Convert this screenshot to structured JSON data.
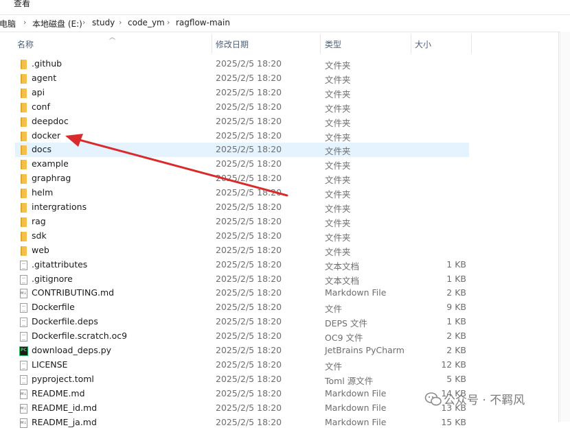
{
  "menu": {
    "view": "查看"
  },
  "breadcrumb": [
    "此电脑",
    "本地磁盘 (E:)",
    "study",
    "code_ym",
    "ragflow-main"
  ],
  "columns": {
    "name": "名称",
    "date": "修改日期",
    "type": "类型",
    "size": "大小"
  },
  "files": [
    {
      "name": ".github",
      "date": "2025/2/5 18:20",
      "type": "文件夹",
      "size": "",
      "icon": "folder-icon"
    },
    {
      "name": "agent",
      "date": "2025/2/5 18:20",
      "type": "文件夹",
      "size": "",
      "icon": "folder-icon"
    },
    {
      "name": "api",
      "date": "2025/2/5 18:20",
      "type": "文件夹",
      "size": "",
      "icon": "folder-icon"
    },
    {
      "name": "conf",
      "date": "2025/2/5 18:20",
      "type": "文件夹",
      "size": "",
      "icon": "folder-icon"
    },
    {
      "name": "deepdoc",
      "date": "2025/2/5 18:20",
      "type": "文件夹",
      "size": "",
      "icon": "folder-icon"
    },
    {
      "name": "docker",
      "date": "2025/2/5 18:20",
      "type": "文件夹",
      "size": "",
      "icon": "folder-icon"
    },
    {
      "name": "docs",
      "date": "2025/2/5 18:20",
      "type": "文件夹",
      "size": "",
      "icon": "folder-icon",
      "selected": true
    },
    {
      "name": "example",
      "date": "2025/2/5 18:20",
      "type": "文件夹",
      "size": "",
      "icon": "folder-icon"
    },
    {
      "name": "graphrag",
      "date": "2025/2/5 18:20",
      "type": "文件夹",
      "size": "",
      "icon": "folder-icon"
    },
    {
      "name": "helm",
      "date": "2025/2/5 18:20",
      "type": "文件夹",
      "size": "",
      "icon": "folder-icon"
    },
    {
      "name": "intergrations",
      "date": "2025/2/5 18:20",
      "type": "文件夹",
      "size": "",
      "icon": "folder-icon"
    },
    {
      "name": "rag",
      "date": "2025/2/5 18:20",
      "type": "文件夹",
      "size": "",
      "icon": "folder-icon"
    },
    {
      "name": "sdk",
      "date": "2025/2/5 18:20",
      "type": "文件夹",
      "size": "",
      "icon": "folder-icon"
    },
    {
      "name": "web",
      "date": "2025/2/5 18:20",
      "type": "文件夹",
      "size": "",
      "icon": "folder-icon"
    },
    {
      "name": ".gitattributes",
      "date": "2025/2/5 18:20",
      "type": "文本文档",
      "size": "1 KB",
      "icon": "text-file-icon"
    },
    {
      "name": ".gitignore",
      "date": "2025/2/5 18:20",
      "type": "文本文档",
      "size": "1 KB",
      "icon": "text-file-icon"
    },
    {
      "name": "CONTRIBUTING.md",
      "date": "2025/2/5 18:20",
      "type": "Markdown File",
      "size": "2 KB",
      "icon": "markdown-file-icon"
    },
    {
      "name": "Dockerfile",
      "date": "2025/2/5 18:20",
      "type": "文件",
      "size": "9 KB",
      "icon": "file-icon"
    },
    {
      "name": "Dockerfile.deps",
      "date": "2025/2/5 18:20",
      "type": "DEPS 文件",
      "size": "1 KB",
      "icon": "file-icon"
    },
    {
      "name": "Dockerfile.scratch.oc9",
      "date": "2025/2/5 18:20",
      "type": "OC9 文件",
      "size": "2 KB",
      "icon": "file-icon"
    },
    {
      "name": "download_deps.py",
      "date": "2025/2/5 18:20",
      "type": "JetBrains PyCharm",
      "size": "2 KB",
      "icon": "pycharm-file-icon"
    },
    {
      "name": "LICENSE",
      "date": "2025/2/5 18:20",
      "type": "文件",
      "size": "12 KB",
      "icon": "file-icon"
    },
    {
      "name": "pyproject.toml",
      "date": "2025/2/5 18:20",
      "type": "Toml 源文件",
      "size": "5 KB",
      "icon": "file-icon"
    },
    {
      "name": "README.md",
      "date": "2025/2/5 18:20",
      "type": "Markdown File",
      "size": "14 KB",
      "icon": "markdown-file-icon"
    },
    {
      "name": "README_id.md",
      "date": "2025/2/5 18:20",
      "type": "Markdown File",
      "size": "13 KB",
      "icon": "markdown-file-icon"
    },
    {
      "name": "README_ja.md",
      "date": "2025/2/5 18:20",
      "type": "Markdown File",
      "size": "15 KB",
      "icon": "markdown-file-icon"
    }
  ],
  "annotation": {
    "color": "#d92b2b"
  },
  "watermark": {
    "text": "公众号 · 不羁风",
    "icon": "wechat-icon"
  },
  "colors": {
    "selection": "#e5f3ff",
    "folder": "#f4c04a",
    "header_text": "#4c607a"
  }
}
